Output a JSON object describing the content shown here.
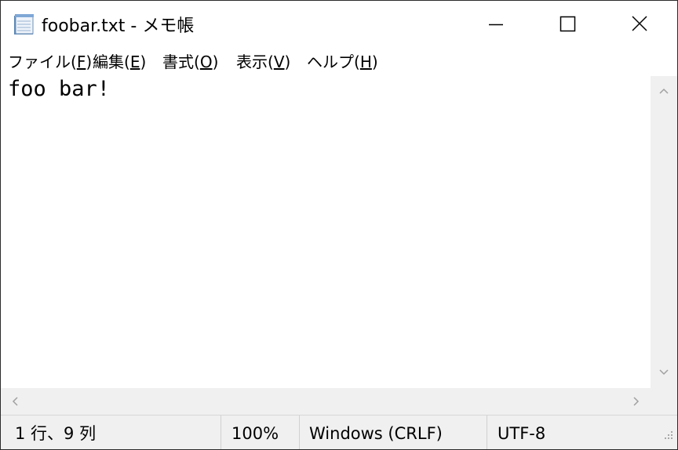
{
  "window": {
    "title": "foobar.txt - メモ帳",
    "app_icon": "notepad-icon",
    "controls": {
      "minimize_icon": "minimize-icon",
      "maximize_icon": "maximize-icon",
      "close_icon": "close-icon"
    }
  },
  "menu": {
    "items": [
      {
        "text": "ファイル(",
        "key": "F",
        "suffix": ")"
      },
      {
        "text": "編集(",
        "key": "E",
        "suffix": ")"
      },
      {
        "text": "書式(",
        "key": "O",
        "suffix": ")"
      },
      {
        "text": "表示(",
        "key": "V",
        "suffix": ")"
      },
      {
        "text": "ヘルプ(",
        "key": "H",
        "suffix": ")"
      }
    ]
  },
  "editor": {
    "content": "foo bar!"
  },
  "statusbar": {
    "position": "1 行、9 列",
    "zoom": "100%",
    "line_ending": "Windows (CRLF)",
    "encoding": "UTF-8"
  },
  "colors": {
    "scrollbar_bg": "#f0f0f0",
    "arrow": "#a0a0a0",
    "text": "#000000"
  }
}
